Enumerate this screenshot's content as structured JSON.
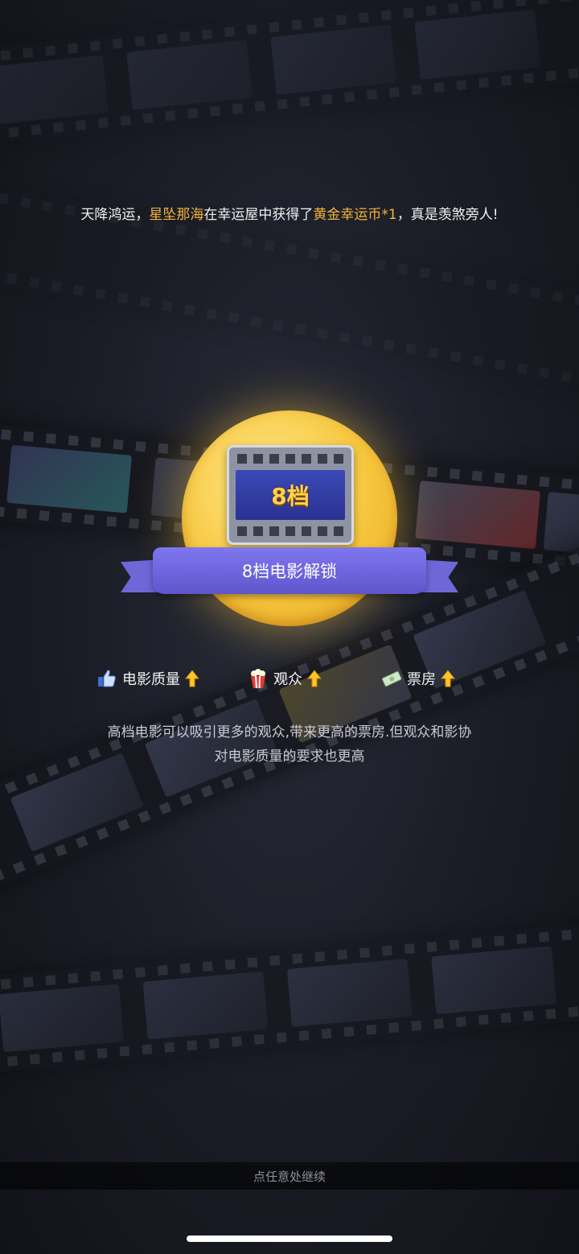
{
  "announcement": {
    "prefix": "天降鸿运，",
    "player": "星坠那海",
    "middle": "在幸运屋中获得了",
    "item": "黄金幸运币*1",
    "suffix": "，真是羡煞旁人!"
  },
  "badge": {
    "level_label": "8档",
    "ribbon_text": "8档电影解锁"
  },
  "stats": [
    {
      "label": "电影质量",
      "icon": "thumbs-up-icon",
      "trend": "up"
    },
    {
      "label": "观众",
      "icon": "popcorn-icon",
      "trend": "up"
    },
    {
      "label": "票房",
      "icon": "money-icon",
      "trend": "up"
    }
  ],
  "description": {
    "line1": "高档电影可以吸引更多的观众,带来更高的票房.但观众和影协",
    "line2": "对电影质量的要求也更高"
  },
  "continue_text": "点任意处继续",
  "colors": {
    "highlight": "#f4b43a",
    "ribbon": "#6f67d8",
    "gold": "#f6c53b"
  }
}
